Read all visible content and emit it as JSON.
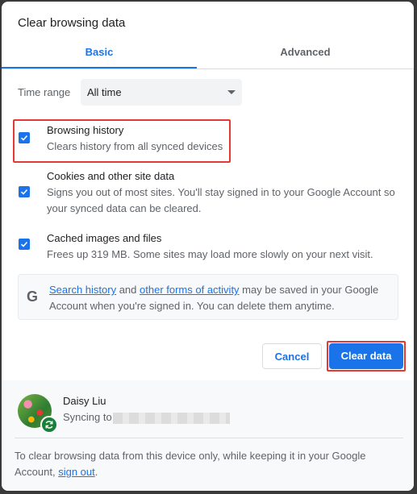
{
  "dialog": {
    "title": "Clear browsing data"
  },
  "tabs": [
    {
      "label": "Basic",
      "active": true
    },
    {
      "label": "Advanced",
      "active": false
    }
  ],
  "time_range": {
    "label": "Time range",
    "value": "All time"
  },
  "items": [
    {
      "label": "Browsing history",
      "description": "Clears history from all synced devices",
      "checked": true
    },
    {
      "label": "Cookies and other site data",
      "description": "Signs you out of most sites. You'll stay signed in to your Google Account so your synced data can be cleared.",
      "checked": true
    },
    {
      "label": "Cached images and files",
      "description": "Frees up 319 MB. Some sites may load more slowly on your next visit.",
      "checked": true
    }
  ],
  "info": {
    "icon": "google-g-icon",
    "link1": "Search history",
    "mid": " and ",
    "link2": "other forms of activity",
    "rest": " may be saved in your Google Account when you're signed in. You can delete them anytime."
  },
  "buttons": {
    "cancel": "Cancel",
    "clear": "Clear data"
  },
  "account": {
    "name": "Daisy Liu",
    "status": "Syncing to"
  },
  "footer": {
    "text": "To clear browsing data from this device only, while keeping it in your Google Account, ",
    "link": "sign out",
    "end": "."
  },
  "colors": {
    "accent": "#1a73e8",
    "highlight": "#e53935",
    "sync": "#188038"
  }
}
